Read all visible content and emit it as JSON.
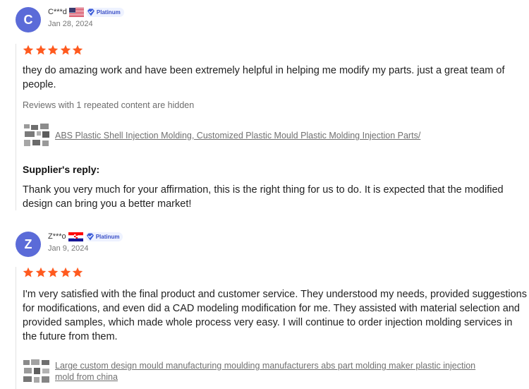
{
  "reviews": [
    {
      "avatar_letter": "C",
      "user_name": "C***d",
      "country_flag": "us-flag-icon",
      "badge": "Platinum",
      "date": "Jan 28, 2024",
      "rating": 5,
      "text": "they do amazing work and have been extremely helpful in helping me modify my parts. just a great team of people.",
      "hidden_note": "Reviews with 1 repeated content are hidden",
      "product_link": "ABS Plastic Shell Injection Molding, Customized Plastic Mould Plastic Molding Injection Parts/",
      "reply_title": "Supplier's reply:",
      "reply_text": "Thank you very much for your affirmation, this is the right thing for us to do. It is expected that the modified design can bring you a better market!"
    },
    {
      "avatar_letter": "Z",
      "user_name": "Z***o",
      "country_flag": "croatia-flag-icon",
      "badge": "Platinum",
      "date": "Jan 9, 2024",
      "rating": 5,
      "text": "I'm very satisfied with the final product and customer service. They understood my needs, provided suggestions for modifications, and even did a CAD modeling modification for me. They assisted with material selection and provided samples, which made whole process very easy. I will continue to order injection molding services in the future from them.",
      "product_link_line1": "Large custom design mould manufacturing moulding manufacturers abs part molding maker plastic injection",
      "product_link_line2": "mold from china"
    }
  ],
  "colors": {
    "avatar": "#5b6bd8",
    "star": "#ff5a1f",
    "badge_text": "#3a4fc6",
    "link": "#707070"
  }
}
